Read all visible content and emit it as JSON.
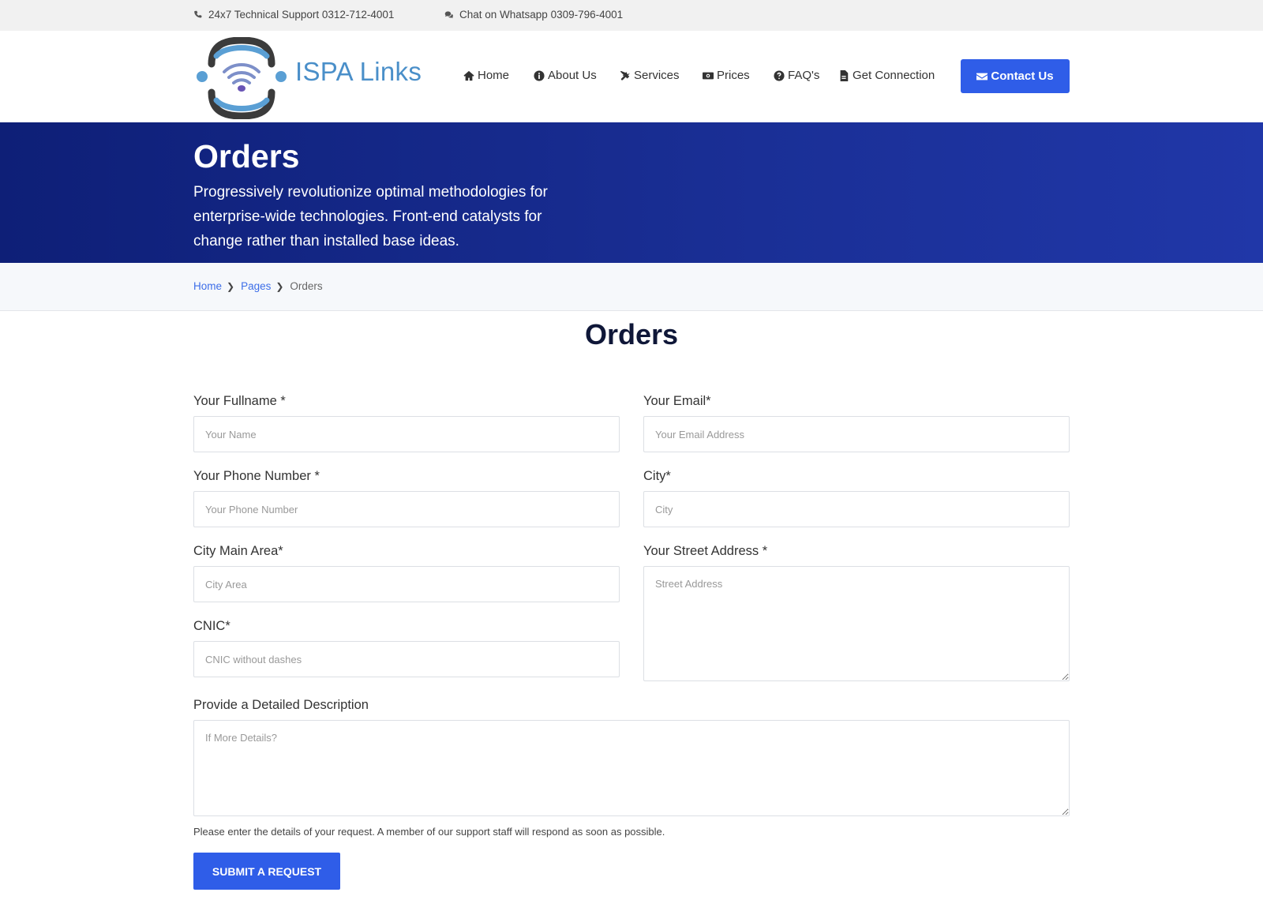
{
  "topbar": {
    "support_text": "24x7 Technical Support 0312-712-4001",
    "chat_text": "Chat on Whatsapp 0309-796-4001"
  },
  "brand": {
    "name": "ISPA Links"
  },
  "nav": {
    "home": "Home",
    "about": "About Us",
    "services": "Services",
    "prices": "Prices",
    "faq": "FAQ's",
    "connection": "Get Connection",
    "contact": "Contact Us"
  },
  "hero": {
    "title": "Orders",
    "description": "Progressively revolutionize optimal methodologies for enterprise-wide technologies. Front-end catalysts for change rather than installed base ideas."
  },
  "breadcrumb": {
    "home": "Home",
    "pages": "Pages",
    "current": "Orders"
  },
  "form": {
    "heading": "Orders",
    "fullname": {
      "label": "Your Fullname *",
      "placeholder": "Your Name"
    },
    "email": {
      "label": "Your Email*",
      "placeholder": "Your Email Address"
    },
    "phone": {
      "label": "Your Phone Number *",
      "placeholder": "Your Phone Number"
    },
    "city": {
      "label": "City*",
      "placeholder": "City"
    },
    "area": {
      "label": "City Main Area*",
      "placeholder": "City Area"
    },
    "street": {
      "label": "Your Street Address *",
      "placeholder": "Street Address"
    },
    "cnic": {
      "label": "CNIC*",
      "placeholder": "CNIC without dashes"
    },
    "description": {
      "label": "Provide a Detailed Description",
      "placeholder": "If More Details?"
    },
    "help_text": "Please enter the details of your request. A member of our support staff will respond as soon as possible.",
    "submit_label": "SUBMIT A REQUEST"
  },
  "colors": {
    "accent": "#2f5de8",
    "hero_dark": "#0e1f77",
    "brand_text": "#4a8fc9",
    "heading": "#0f1738"
  }
}
